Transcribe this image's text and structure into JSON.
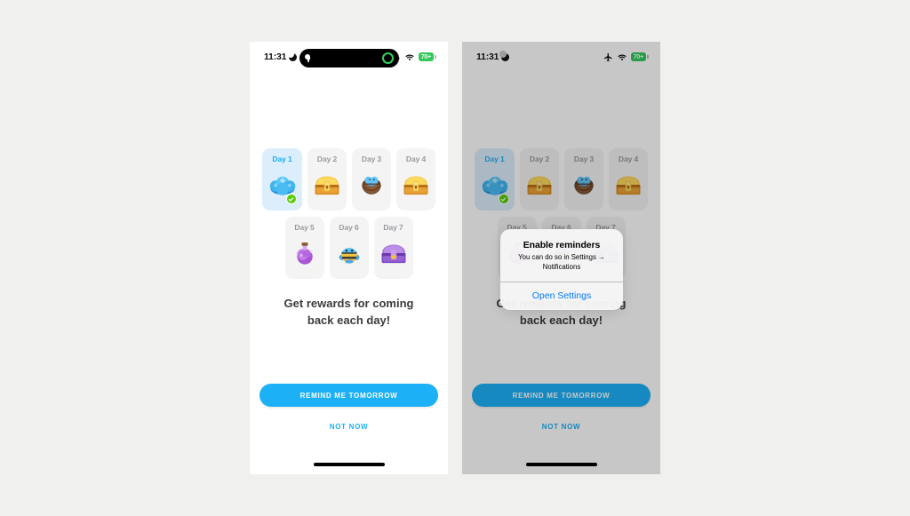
{
  "page": {
    "background_color": "#f0f0ee"
  },
  "status_bar": {
    "time": "11:31",
    "moon_icon": "moon-crescent-icon",
    "airplane_icon": "airplane-mode-icon",
    "wifi_icon": "wifi-icon",
    "battery_label": "70+",
    "battery_color": "#34c759"
  },
  "dynamic_island": {
    "left_glyph": "call-glyph-icon",
    "right_ring": "recording-ring-icon",
    "ring_color": "#30d158"
  },
  "rewards": {
    "row1": [
      {
        "day_label": "Day 1",
        "art": "blue-gems-icon",
        "active": true,
        "completed": true
      },
      {
        "day_label": "Day 2",
        "art": "gold-chest-icon",
        "active": false,
        "completed": false
      },
      {
        "day_label": "Day 3",
        "art": "basket-bird-icon",
        "active": false,
        "completed": false
      },
      {
        "day_label": "Day 4",
        "art": "gold-chest-icon",
        "active": false,
        "completed": false
      }
    ],
    "row2": [
      {
        "day_label": "Day 5",
        "art": "purple-potion-icon",
        "active": false,
        "completed": false
      },
      {
        "day_label": "Day 6",
        "art": "bee-character-icon",
        "active": false,
        "completed": false
      },
      {
        "day_label": "Day 7",
        "art": "purple-chest-icon",
        "active": false,
        "completed": false
      }
    ],
    "active_color": "#1cb0f6",
    "active_card_background": "#dcedfb",
    "inactive_card_background": "#f4f4f5",
    "check_badge_color": "#58cc02"
  },
  "headline": "Get rewards for coming back each day!",
  "buttons": {
    "primary_label": "REMIND ME TOMORROW",
    "primary_color": "#1cb0f6",
    "secondary_label": "NOT NOW",
    "secondary_color": "#1cb0f6"
  },
  "alert": {
    "title": "Enable reminders",
    "message": "You can do so in Settings → Notifications",
    "action_label": "Open Settings",
    "action_color": "#007aff"
  }
}
